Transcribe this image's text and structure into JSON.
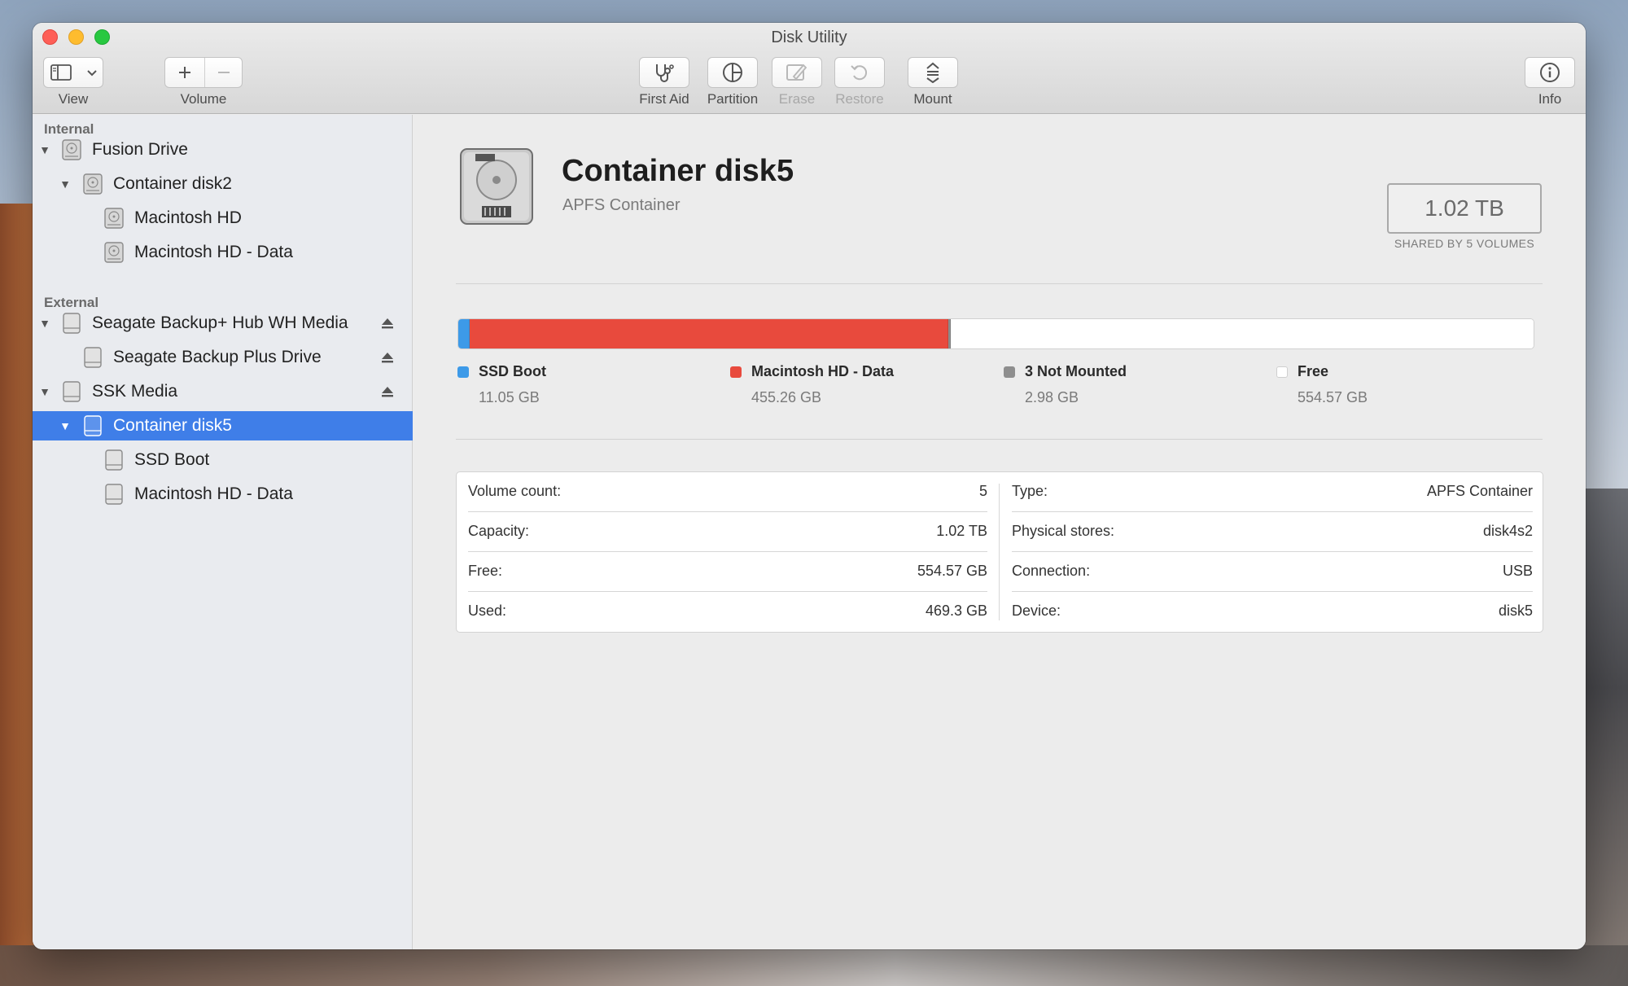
{
  "window": {
    "title": "Disk Utility"
  },
  "toolbar": {
    "view_label": "View",
    "volume_label": "Volume",
    "first_aid_label": "First Aid",
    "partition_label": "Partition",
    "erase_label": "Erase",
    "restore_label": "Restore",
    "mount_label": "Mount",
    "info_label": "Info"
  },
  "sidebar": {
    "internal_header": "Internal",
    "external_header": "External",
    "internal_items": [
      {
        "label": "Fusion Drive",
        "icon": "internal-drive-icon",
        "expanded": true
      },
      {
        "label": "Container disk2",
        "icon": "internal-drive-icon",
        "expanded": true
      },
      {
        "label": "Macintosh HD",
        "icon": "internal-drive-icon"
      },
      {
        "label": "Macintosh HD - Data",
        "icon": "internal-drive-icon"
      }
    ],
    "external_items": [
      {
        "label": "Seagate Backup+ Hub WH Media",
        "icon": "external-drive-icon",
        "expanded": true,
        "ejectable": true
      },
      {
        "label": "Seagate Backup Plus Drive",
        "icon": "external-drive-icon",
        "ejectable": true
      },
      {
        "label": "SSK Media",
        "icon": "external-drive-icon",
        "expanded": true,
        "ejectable": true
      },
      {
        "label": "Container disk5",
        "icon": "external-drive-icon",
        "expanded": true,
        "selected": true
      },
      {
        "label": "SSD Boot",
        "icon": "external-drive-icon"
      },
      {
        "label": "Macintosh HD - Data",
        "icon": "external-drive-icon"
      }
    ]
  },
  "detail": {
    "title": "Container disk5",
    "subtitle": "APFS Container",
    "capacity": "1.02 TB",
    "capacity_note": "SHARED BY 5 VOLUMES",
    "usage": [
      {
        "name": "SSD Boot",
        "size": "11.05 GB",
        "gb": 11.05,
        "color": "#3d9ae8"
      },
      {
        "name": "Macintosh HD - Data",
        "size": "455.26 GB",
        "gb": 455.26,
        "color": "#e84a3d"
      },
      {
        "name": "3 Not Mounted",
        "size": "2.98 GB",
        "gb": 2.98,
        "color": "#8e8e8e"
      },
      {
        "name": "Free",
        "size": "554.57 GB",
        "gb": 554.57,
        "color": "#ffffff"
      }
    ],
    "info_left": [
      {
        "key": "Volume count:",
        "value": "5"
      },
      {
        "key": "Capacity:",
        "value": "1.02 TB"
      },
      {
        "key": "Free:",
        "value": "554.57 GB"
      },
      {
        "key": "Used:",
        "value": "469.3 GB"
      }
    ],
    "info_right": [
      {
        "key": "Type:",
        "value": "APFS Container"
      },
      {
        "key": "Physical stores:",
        "value": "disk4s2"
      },
      {
        "key": "Connection:",
        "value": "USB"
      },
      {
        "key": "Device:",
        "value": "disk5"
      }
    ]
  }
}
